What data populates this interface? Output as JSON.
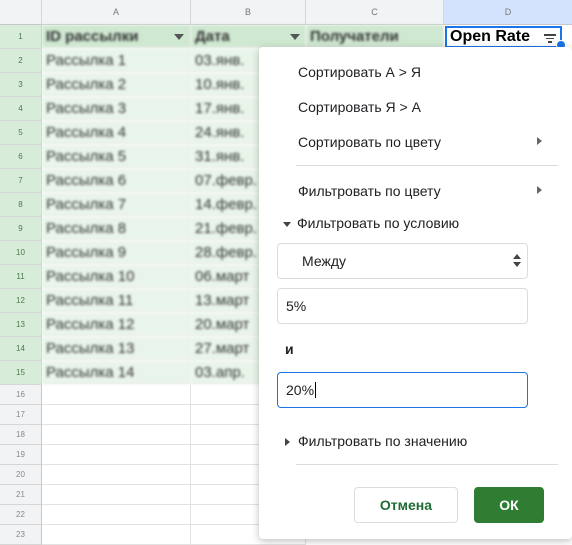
{
  "columns": [
    "A",
    "B",
    "C",
    "D"
  ],
  "headers": {
    "a": "ID рассылки",
    "b": "Дата",
    "c": "Получатели",
    "d": "Open Rate"
  },
  "rows": [
    {
      "num": "1",
      "a": "",
      "b": ""
    },
    {
      "num": "2",
      "a": "Рассылка 1",
      "b": "03.янв."
    },
    {
      "num": "3",
      "a": "Рассылка 2",
      "b": "10.янв."
    },
    {
      "num": "4",
      "a": "Рассылка 3",
      "b": "17.янв."
    },
    {
      "num": "5",
      "a": "Рассылка 4",
      "b": "24.янв."
    },
    {
      "num": "6",
      "a": "Рассылка 5",
      "b": "31.янв."
    },
    {
      "num": "7",
      "a": "Рассылка 6",
      "b": "07.февр."
    },
    {
      "num": "8",
      "a": "Рассылка 7",
      "b": "14.февр."
    },
    {
      "num": "9",
      "a": "Рассылка 8",
      "b": "21.февр."
    },
    {
      "num": "10",
      "a": "Рассылка 9",
      "b": "28.февр."
    },
    {
      "num": "11",
      "a": "Рассылка 10",
      "b": "06.март"
    },
    {
      "num": "12",
      "a": "Рассылка 11",
      "b": "13.март"
    },
    {
      "num": "13",
      "a": "Рассылка 12",
      "b": "20.март"
    },
    {
      "num": "14",
      "a": "Рассылка 13",
      "b": "27.март"
    },
    {
      "num": "15",
      "a": "Рассылка 14",
      "b": "03.апр."
    }
  ],
  "empty_rows": [
    "16",
    "17",
    "18",
    "19",
    "20",
    "21",
    "22",
    "23"
  ],
  "menu": {
    "sort_az": "Сортировать А > Я",
    "sort_za": "Сортировать Я > А",
    "sort_color": "Сортировать по цвету",
    "filter_color": "Фильтровать по цвету",
    "filter_condition": "Фильтровать по условию",
    "condition_value": "Между",
    "from_value": "5%",
    "and_label": "и",
    "to_value": "20%",
    "filter_values": "Фильтровать по значению",
    "cancel": "Отмена",
    "ok": "ОК"
  },
  "colors": {
    "accent": "#1a73e8",
    "ok_green": "#2e7d32",
    "filtered": "#e9f5ea"
  }
}
